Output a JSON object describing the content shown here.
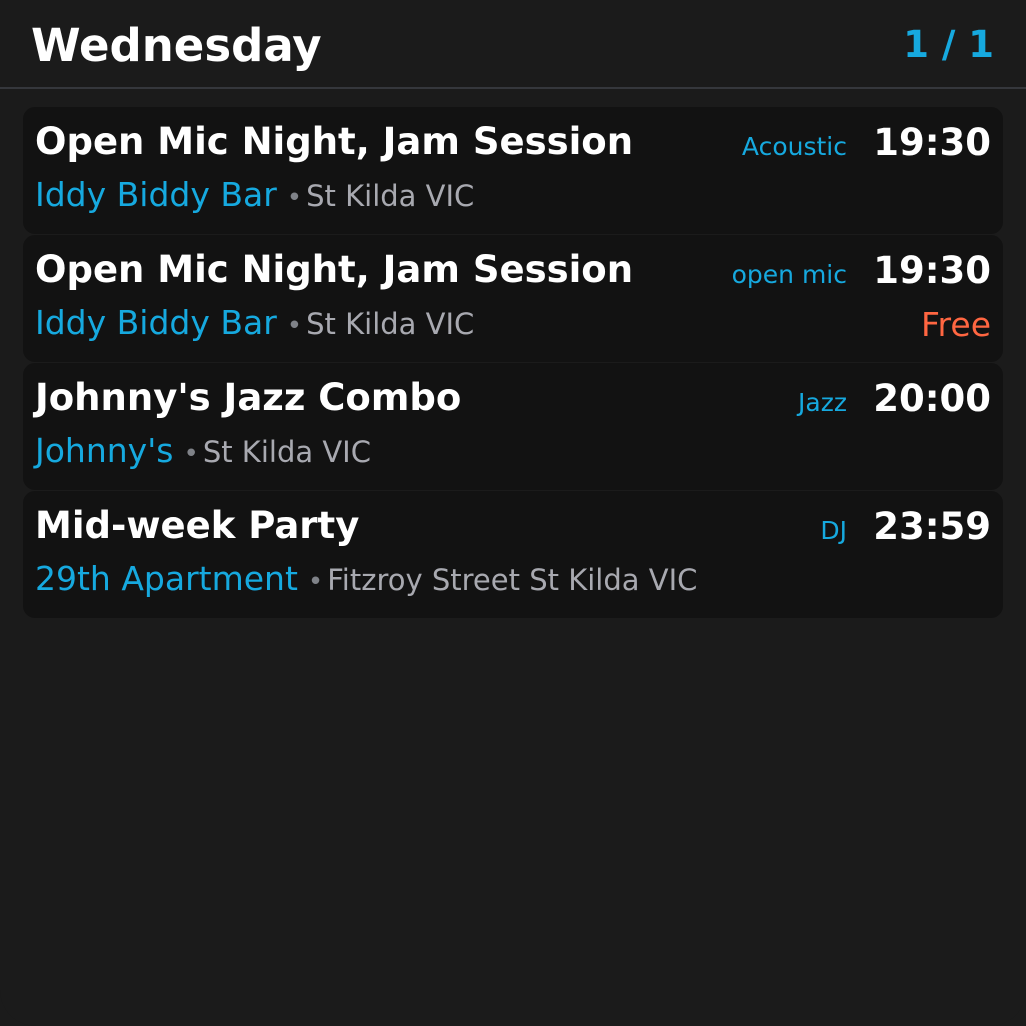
{
  "header": {
    "title": "Wednesday",
    "page_indicator": "1 / 1"
  },
  "separator": "•",
  "colors": {
    "background": "#1b1b1b",
    "card": "#121212",
    "accent": "#16a9df",
    "price": "#ff6641",
    "muted": "#a8a9b0"
  },
  "events": [
    {
      "title": "Open Mic Night, Jam Session",
      "genre": "Acoustic",
      "time": "19:30",
      "venue": "Iddy Biddy Bar",
      "location": "St Kilda VIC",
      "price": ""
    },
    {
      "title": "Open Mic Night, Jam Session",
      "genre": "open mic",
      "time": "19:30",
      "venue": "Iddy Biddy Bar",
      "location": "St Kilda VIC",
      "price": "Free"
    },
    {
      "title": "Johnny's Jazz Combo",
      "genre": "Jazz",
      "time": "20:00",
      "venue": "Johnny's",
      "location": "St Kilda VIC",
      "price": ""
    },
    {
      "title": "Mid-week Party",
      "genre": "DJ",
      "time": "23:59",
      "venue": "29th Apartment",
      "location": "Fitzroy Street St Kilda VIC",
      "price": ""
    }
  ]
}
